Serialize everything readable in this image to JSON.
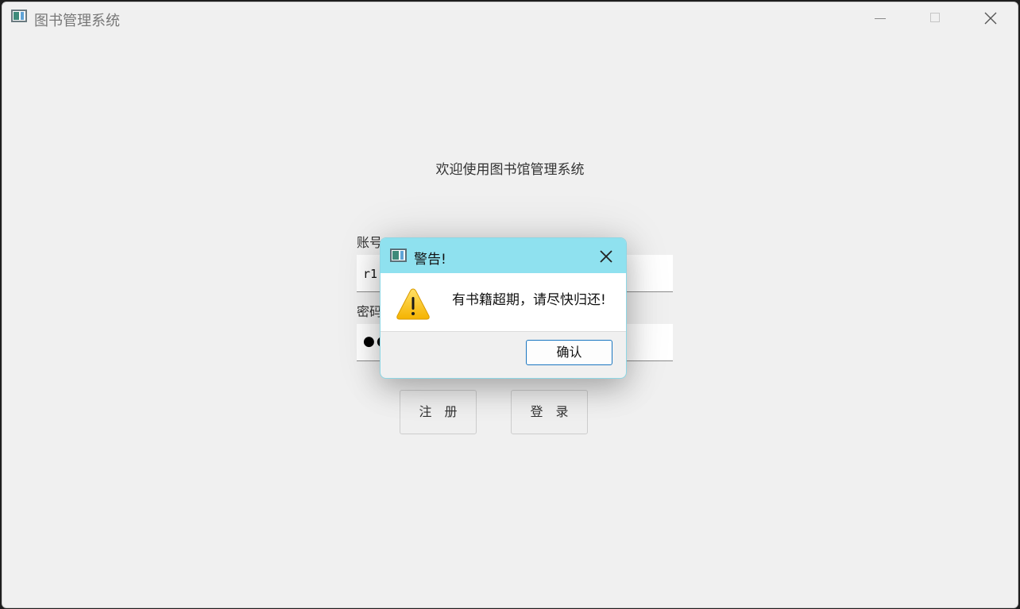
{
  "window": {
    "title": "图书管理系统",
    "welcome": "欢迎使用图书馆管理系统",
    "account_label": "账号",
    "account_value": "r1",
    "password_label": "密码",
    "password_mask": "●●●",
    "register_label": "注　册",
    "login_label": "登　录"
  },
  "dialog": {
    "title": "警告!",
    "message": "有书籍超期，请尽快归还!",
    "ok_label": "确认",
    "title_bar_color": "#8fe1ef",
    "icon": "warning-icon"
  },
  "icons": [
    "app-icon",
    "minimize-icon",
    "maximize-icon",
    "close-icon",
    "warning-icon"
  ]
}
